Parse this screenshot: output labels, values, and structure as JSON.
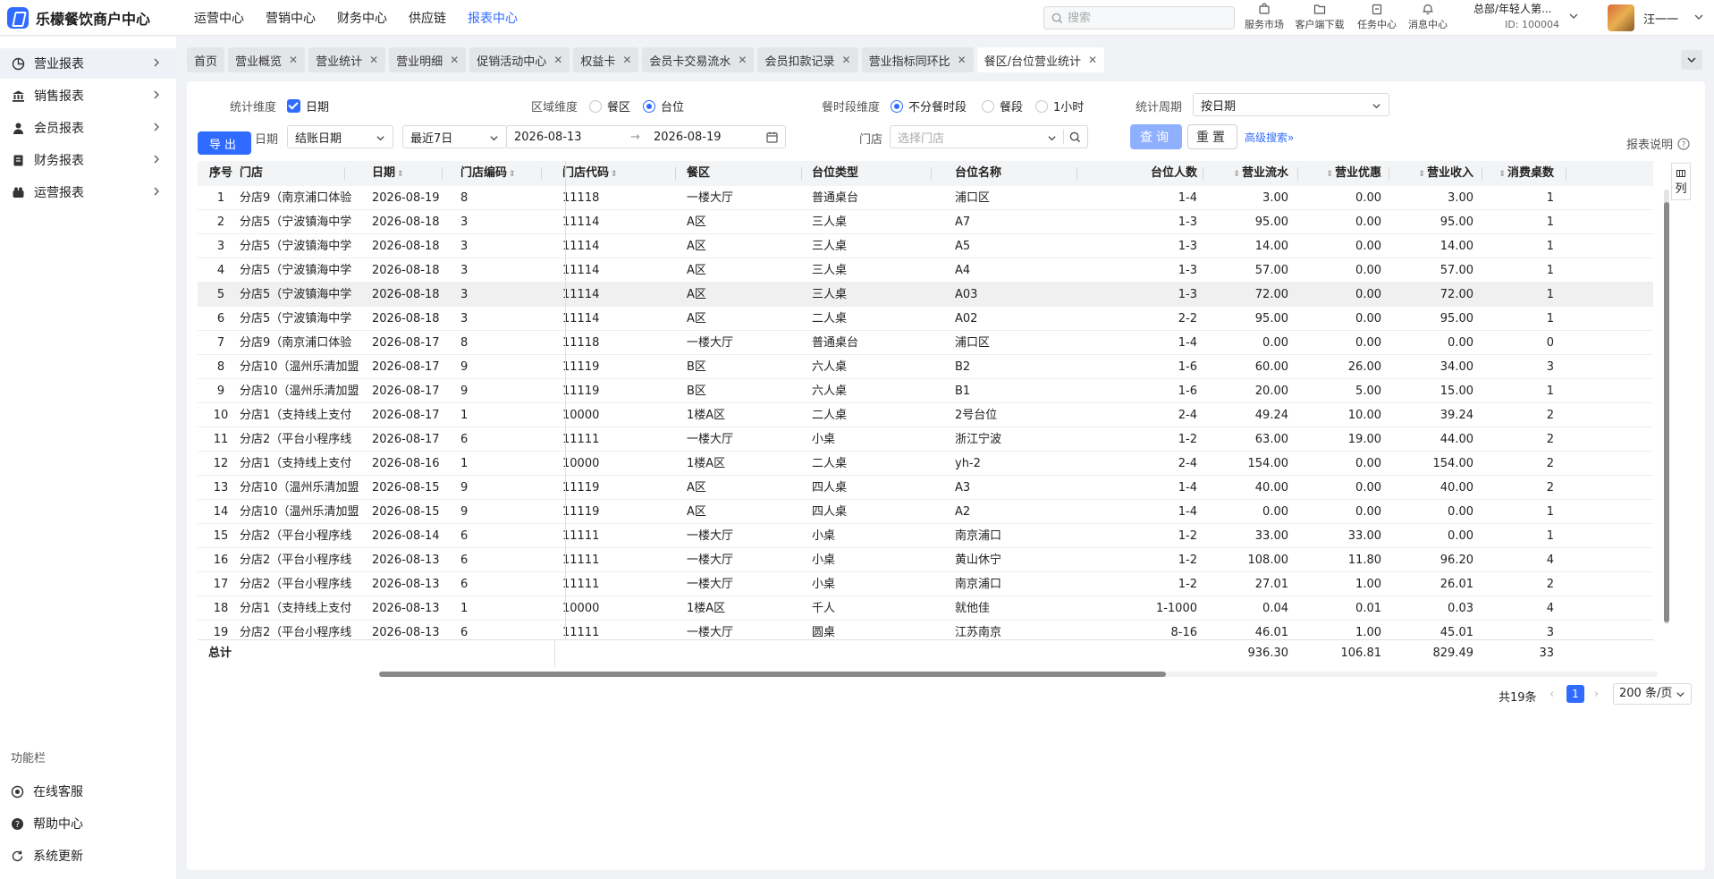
{
  "app": {
    "title": "乐檬餐饮商户中心"
  },
  "topnav": [
    "运营中心",
    "营销中心",
    "财务中心",
    "供应链",
    "报表中心"
  ],
  "search": {
    "placeholder": "搜索"
  },
  "quick": [
    "服务市场",
    "客户端下载",
    "任务中心",
    "消息中心"
  ],
  "account": {
    "name": "总部/年轻人第...",
    "id": "ID: 100004",
    "user": "汪一一"
  },
  "sidebar": {
    "items": [
      "营业报表",
      "销售报表",
      "会员报表",
      "财务报表",
      "运营报表"
    ],
    "func_title": "功能栏",
    "func": [
      "在线客服",
      "帮助中心",
      "系统更新"
    ]
  },
  "tabs": [
    "首页",
    "营业概览",
    "营业统计",
    "营业明细",
    "促销活动中心",
    "权益卡",
    "会员卡交易流水",
    "会员扣款记录",
    "营业指标同环比",
    "餐区/台位营业统计"
  ],
  "filters": {
    "stat_dim_label": "统计维度",
    "stat_dim_opt": "日期",
    "area_dim_label": "区域维度",
    "area_opt1": "餐区",
    "area_opt2": "台位",
    "meal_dim_label": "餐时段维度",
    "meal_opt1": "不分餐时段",
    "meal_opt2": "餐段",
    "meal_opt3": "1小时",
    "period_label": "统计周期",
    "period_value": "按日期",
    "date_label": "日期",
    "date_type": "结账日期",
    "date_range": "最近7日",
    "date_start": "2026-08-13",
    "date_sep": "→",
    "date_end": "2026-08-19",
    "store_label": "门店",
    "store_placeholder": "选择门店",
    "query": "查询",
    "reset": "重置",
    "advanced": "高级搜索"
  },
  "export": "导出",
  "report_note": "报表说明",
  "columns": [
    "序号",
    "门店",
    "日期",
    "门店编码",
    "门店代码",
    "餐区",
    "台位类型",
    "台位名称",
    "台位人数",
    "营业流水",
    "营业优惠",
    "营业收入",
    "消费桌数"
  ],
  "col_btn": "列",
  "rows": [
    [
      "1",
      "分店9（南京浦口体验",
      "2026-08-19",
      "8",
      "11118",
      "一楼大厅",
      "普通桌台",
      "浦口区",
      "1-4",
      "3.00",
      "0.00",
      "3.00",
      "1"
    ],
    [
      "2",
      "分店5（宁波镇海中学",
      "2026-08-18",
      "3",
      "11114",
      "A区",
      "三人桌",
      "A7",
      "1-3",
      "95.00",
      "0.00",
      "95.00",
      "1"
    ],
    [
      "3",
      "分店5（宁波镇海中学",
      "2026-08-18",
      "3",
      "11114",
      "A区",
      "三人桌",
      "A5",
      "1-3",
      "14.00",
      "0.00",
      "14.00",
      "1"
    ],
    [
      "4",
      "分店5（宁波镇海中学",
      "2026-08-18",
      "3",
      "11114",
      "A区",
      "三人桌",
      "A4",
      "1-3",
      "57.00",
      "0.00",
      "57.00",
      "1"
    ],
    [
      "5",
      "分店5（宁波镇海中学",
      "2026-08-18",
      "3",
      "11114",
      "A区",
      "三人桌",
      "A03",
      "1-3",
      "72.00",
      "0.00",
      "72.00",
      "1"
    ],
    [
      "6",
      "分店5（宁波镇海中学",
      "2026-08-18",
      "3",
      "11114",
      "A区",
      "二人桌",
      "A02",
      "2-2",
      "95.00",
      "0.00",
      "95.00",
      "1"
    ],
    [
      "7",
      "分店9（南京浦口体验",
      "2026-08-17",
      "8",
      "11118",
      "一楼大厅",
      "普通桌台",
      "浦口区",
      "1-4",
      "0.00",
      "0.00",
      "0.00",
      "0"
    ],
    [
      "8",
      "分店10（温州乐清加盟",
      "2026-08-17",
      "9",
      "11119",
      "B区",
      "六人桌",
      "B2",
      "1-6",
      "60.00",
      "26.00",
      "34.00",
      "3"
    ],
    [
      "9",
      "分店10（温州乐清加盟",
      "2026-08-17",
      "9",
      "11119",
      "B区",
      "六人桌",
      "B1",
      "1-6",
      "20.00",
      "5.00",
      "15.00",
      "1"
    ],
    [
      "10",
      "分店1（支持线上支付",
      "2026-08-17",
      "1",
      "10000",
      "1楼A区",
      "二人桌",
      "2号台位",
      "2-4",
      "49.24",
      "10.00",
      "39.24",
      "2"
    ],
    [
      "11",
      "分店2（平台小程序线",
      "2026-08-17",
      "6",
      "11111",
      "一楼大厅",
      "小桌",
      "浙江宁波",
      "1-2",
      "63.00",
      "19.00",
      "44.00",
      "2"
    ],
    [
      "12",
      "分店1（支持线上支付",
      "2026-08-16",
      "1",
      "10000",
      "1楼A区",
      "二人桌",
      "yh-2",
      "2-4",
      "154.00",
      "0.00",
      "154.00",
      "2"
    ],
    [
      "13",
      "分店10（温州乐清加盟",
      "2026-08-15",
      "9",
      "11119",
      "A区",
      "四人桌",
      "A3",
      "1-4",
      "40.00",
      "0.00",
      "40.00",
      "2"
    ],
    [
      "14",
      "分店10（温州乐清加盟",
      "2026-08-15",
      "9",
      "11119",
      "A区",
      "四人桌",
      "A2",
      "1-4",
      "0.00",
      "0.00",
      "0.00",
      "1"
    ],
    [
      "15",
      "分店2（平台小程序线",
      "2026-08-14",
      "6",
      "11111",
      "一楼大厅",
      "小桌",
      "南京浦口",
      "1-2",
      "33.00",
      "33.00",
      "0.00",
      "1"
    ],
    [
      "16",
      "分店2（平台小程序线",
      "2026-08-13",
      "6",
      "11111",
      "一楼大厅",
      "小桌",
      "黄山休宁",
      "1-2",
      "108.00",
      "11.80",
      "96.20",
      "4"
    ],
    [
      "17",
      "分店2（平台小程序线",
      "2026-08-13",
      "6",
      "11111",
      "一楼大厅",
      "小桌",
      "南京浦口",
      "1-2",
      "27.01",
      "1.00",
      "26.01",
      "2"
    ],
    [
      "18",
      "分店1（支持线上支付",
      "2026-08-13",
      "1",
      "10000",
      "1楼A区",
      "千人",
      "就他佳",
      "1-1000",
      "0.04",
      "0.01",
      "0.03",
      "4"
    ],
    [
      "19",
      "分店2（平台小程序线",
      "2026-08-13",
      "6",
      "11111",
      "一楼大厅",
      "圆桌",
      "江苏南京",
      "8-16",
      "46.01",
      "1.00",
      "45.01",
      "3"
    ]
  ],
  "totals": {
    "label": "总计",
    "flow": "936.30",
    "discount": "106.81",
    "income": "829.49",
    "tables": "33"
  },
  "pagination": {
    "total": "共19条",
    "current": "1",
    "size": "200 条/页"
  }
}
